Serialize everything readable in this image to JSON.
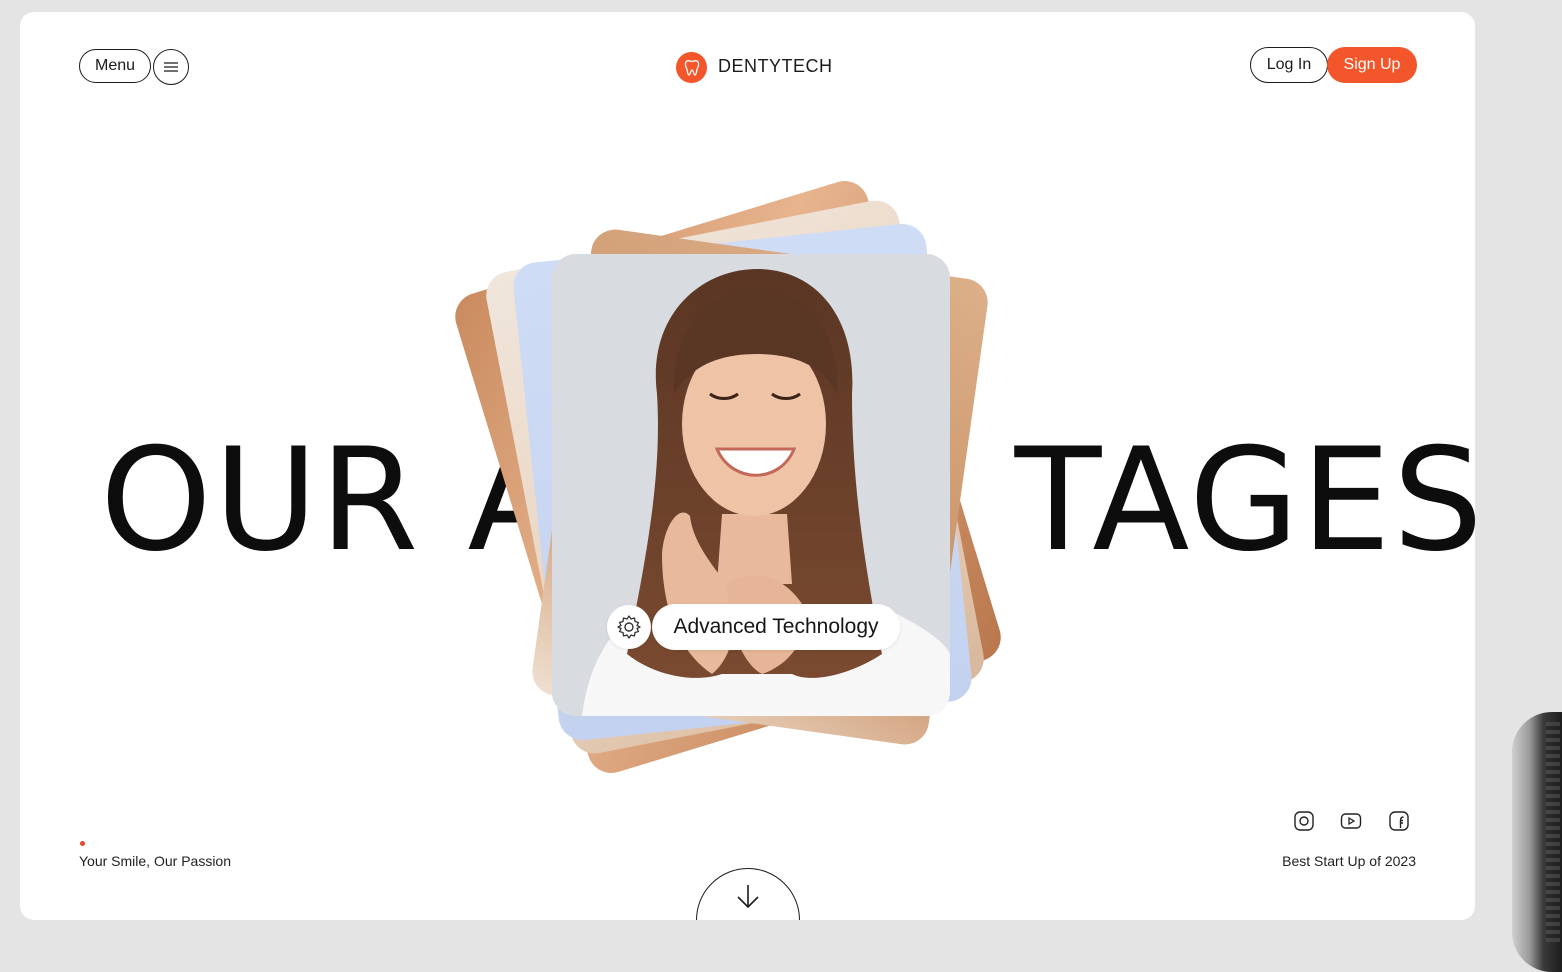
{
  "header": {
    "menu_label": "Menu",
    "brand": "DENTYTECH",
    "login_label": "Log In",
    "signup_label": "Sign Up"
  },
  "hero": {
    "headline_left": "OUR A",
    "headline_right": "TAGES",
    "tag_label": "Advanced Technology"
  },
  "footer": {
    "tagline": "Your Smile, Our Passion",
    "award": "Best Start Up of 2023",
    "social_icons": [
      "instagram-icon",
      "youtube-icon",
      "facebook-icon"
    ]
  },
  "colors": {
    "accent": "#f2562a",
    "text": "#0d0d0d",
    "background": "#ffffff"
  }
}
